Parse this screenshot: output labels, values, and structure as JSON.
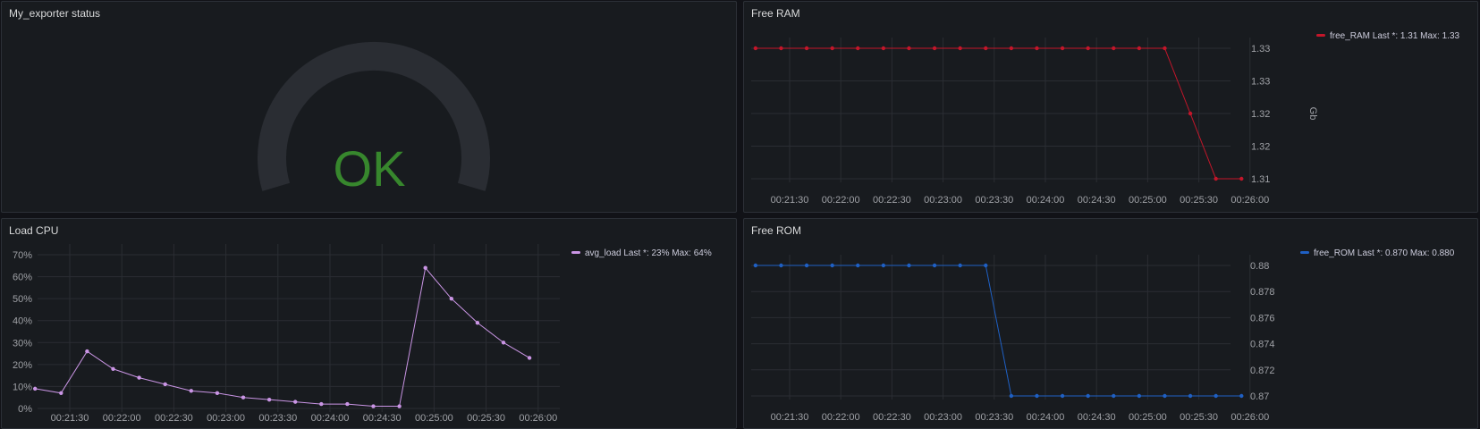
{
  "panels": {
    "status": {
      "title": "My_exporter status",
      "value": "OK",
      "value_color": "#37872d"
    },
    "ram": {
      "title": "Free RAM",
      "unit_label": "Gb",
      "color": "#c4162a"
    },
    "cpu": {
      "title": "Load CPU",
      "color": "#ca95e5"
    },
    "rom": {
      "title": "Free ROM",
      "color": "#1f60c4"
    }
  },
  "chart_data": [
    {
      "id": "ram",
      "type": "line",
      "title": "Free RAM",
      "ylabel": "Gb",
      "x": [
        "00:21:10",
        "00:21:25",
        "00:21:40",
        "00:21:55",
        "00:22:10",
        "00:22:25",
        "00:22:40",
        "00:22:55",
        "00:23:10",
        "00:23:25",
        "00:23:40",
        "00:23:55",
        "00:24:10",
        "00:24:25",
        "00:24:40",
        "00:24:55",
        "00:25:10",
        "00:25:25",
        "00:25:40",
        "00:25:55"
      ],
      "xticks": [
        "00:21:30",
        "00:22:00",
        "00:22:30",
        "00:23:00",
        "00:23:30",
        "00:24:00",
        "00:24:30",
        "00:25:00",
        "00:25:30",
        "00:26:00"
      ],
      "yticks": [
        "1.33",
        "1.33",
        "1.32",
        "1.32",
        "1.31"
      ],
      "series": [
        {
          "name": "free_RAM",
          "values": [
            1.33,
            1.33,
            1.33,
            1.33,
            1.33,
            1.33,
            1.33,
            1.33,
            1.33,
            1.33,
            1.33,
            1.33,
            1.33,
            1.33,
            1.33,
            1.33,
            1.33,
            1.32,
            1.31,
            1.31
          ],
          "legend_text": "free_RAM   Last *: 1.31   Max: 1.33"
        }
      ],
      "grid": true,
      "legend": "top-right"
    },
    {
      "id": "cpu",
      "type": "line",
      "title": "Load CPU",
      "x": [
        "00:21:10",
        "00:21:25",
        "00:21:40",
        "00:21:55",
        "00:22:10",
        "00:22:25",
        "00:22:40",
        "00:22:55",
        "00:23:10",
        "00:23:25",
        "00:23:40",
        "00:23:55",
        "00:24:10",
        "00:24:25",
        "00:24:40",
        "00:24:55",
        "00:25:10",
        "00:25:25",
        "00:25:40",
        "00:25:55"
      ],
      "xticks": [
        "00:21:30",
        "00:22:00",
        "00:22:30",
        "00:23:00",
        "00:23:30",
        "00:24:00",
        "00:24:30",
        "00:25:00",
        "00:25:30",
        "00:26:00"
      ],
      "yticks": [
        "70%",
        "60%",
        "50%",
        "40%",
        "30%",
        "20%",
        "10%",
        "0%"
      ],
      "ylim": [
        0,
        70
      ],
      "series": [
        {
          "name": "avg_load",
          "values": [
            9,
            7,
            26,
            18,
            14,
            11,
            8,
            7,
            5,
            4,
            3,
            2,
            2,
            1,
            1,
            64,
            50,
            39,
            30,
            23
          ],
          "legend_text": "avg_load   Last *: 23%   Max: 64%"
        }
      ],
      "grid": true,
      "legend": "top-right"
    },
    {
      "id": "rom",
      "type": "line",
      "title": "Free ROM",
      "x": [
        "00:21:10",
        "00:21:25",
        "00:21:40",
        "00:21:55",
        "00:22:10",
        "00:22:25",
        "00:22:40",
        "00:22:55",
        "00:23:10",
        "00:23:25",
        "00:23:40",
        "00:23:55",
        "00:24:10",
        "00:24:25",
        "00:24:40",
        "00:24:55",
        "00:25:10",
        "00:25:25",
        "00:25:40",
        "00:25:55"
      ],
      "xticks": [
        "00:21:30",
        "00:22:00",
        "00:22:30",
        "00:23:00",
        "00:23:30",
        "00:24:00",
        "00:24:30",
        "00:25:00",
        "00:25:30",
        "00:26:00"
      ],
      "yticks": [
        "0.88",
        "0.878",
        "0.876",
        "0.874",
        "0.872",
        "0.87"
      ],
      "ylim": [
        0.87,
        0.88
      ],
      "series": [
        {
          "name": "free_ROM",
          "values": [
            0.88,
            0.88,
            0.88,
            0.88,
            0.88,
            0.88,
            0.88,
            0.88,
            0.88,
            0.88,
            0.87,
            0.87,
            0.87,
            0.87,
            0.87,
            0.87,
            0.87,
            0.87,
            0.87,
            0.87
          ],
          "legend_text": "free_ROM   Last *: 0.870   Max: 0.880"
        }
      ],
      "grid": true,
      "legend": "top-right"
    }
  ]
}
